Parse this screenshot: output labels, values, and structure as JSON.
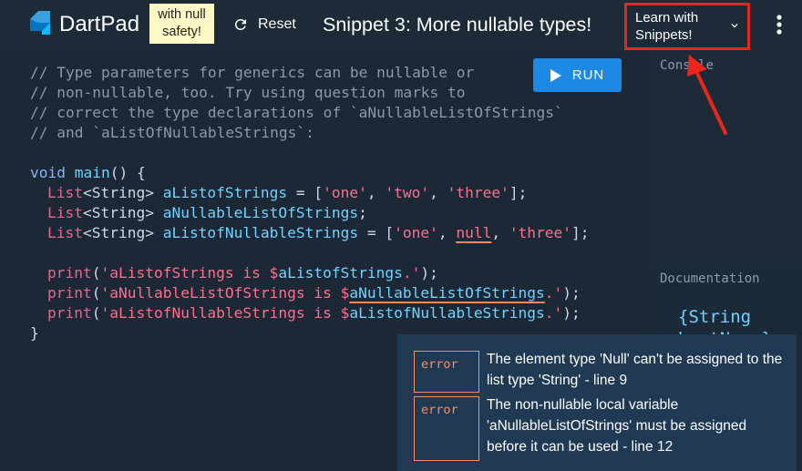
{
  "app": {
    "brand": "DartPad",
    "badge_line1": "with null",
    "badge_line2": "safety!",
    "reset_label": "Reset",
    "title": "Snippet 3: More nullable types!",
    "learn_line1": "Learn with",
    "learn_line2": "Snippets!",
    "accent_color": "#e8261b",
    "run_color": "#1e88e5"
  },
  "editor": {
    "run_label": "RUN",
    "comments": [
      "// Type parameters for generics can be nullable or",
      "// non-nullable, too. Try using question marks to",
      "// correct the type declarations of `aNullableListOfStrings`",
      "// and `aListOfNullableStrings`:"
    ],
    "kw_void": "void",
    "fn_main": "main",
    "main_open": "() {",
    "type_list": "List",
    "type_string": "<String>",
    "var1": "aListofStrings",
    "var2": "aNullableListOfStrings",
    "var3": "aListofNullableStrings",
    "assign": " = [",
    "s_one": "'one'",
    "s_two": "'two'",
    "s_three": "'three'",
    "k_null": "null",
    "comma": ", ",
    "close_list": "];",
    "semicolon": ";",
    "print": "print",
    "p1_str": "'aListofStrings is $",
    "p1_var": "aListofStrings",
    "p1_end": ".'",
    "p2_str": "'aNullableListOfStrings is $",
    "p2_var": "aNullableListOfStrings",
    "p3_str": "'aListofNullableStrings is $",
    "p3_var": "aListofNullableStrings",
    "paren_open": "(",
    "paren_close": ");",
    "brace_close": "}"
  },
  "console": {
    "label": "Console"
  },
  "documentation": {
    "label": "Documentation",
    "code_line1": "{String",
    "code_line2": "hostName}"
  },
  "errors": [
    {
      "badge": "error",
      "message": "The element type 'Null' can't be assigned to the list type 'String' - line 9"
    },
    {
      "badge": "error",
      "message": "The non-nullable local variable 'aNullableListOfStrings' must be assigned before it can be used - line 12"
    }
  ],
  "icons": {
    "logo": "dart-logo-icon",
    "reset": "refresh-icon",
    "run": "play-icon",
    "chevron": "chevron-down-icon",
    "more": "more-vert-icon"
  }
}
